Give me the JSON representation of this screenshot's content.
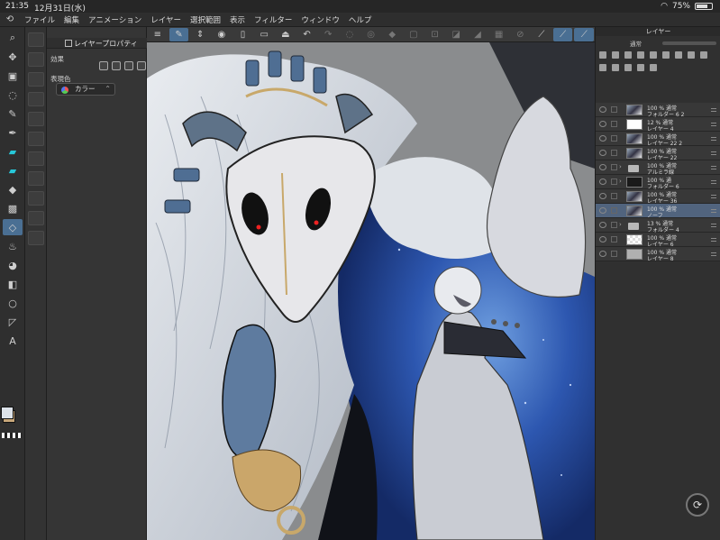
{
  "status": {
    "time": "21:35",
    "date": "12月31日(水)",
    "battery": "75%",
    "battery_level": 0.75,
    "wifi_icon": "wifi-icon"
  },
  "menu": [
    "ファイル",
    "編集",
    "アニメーション",
    "レイヤー",
    "選択範囲",
    "表示",
    "フィルター",
    "ウィンドウ",
    "ヘルプ"
  ],
  "property_panel": {
    "tab_title": "レイヤープロパティ",
    "effect_label": "効果",
    "color_label": "表現色",
    "color_value": "カラー"
  },
  "layer_panel": {
    "title": "レイヤー",
    "blend_mode": "通常",
    "layers": [
      {
        "opacity": "100 % 通常",
        "name": "フォルダー 6 2",
        "kind": "pic"
      },
      {
        "opacity": "12 % 通常",
        "name": "レイヤー 4",
        "kind": "white"
      },
      {
        "opacity": "100 % 通常",
        "name": "レイヤー 22 2",
        "kind": "pic"
      },
      {
        "opacity": "100 % 通常",
        "name": "レイヤー 22",
        "kind": "pic"
      },
      {
        "opacity": "100 % 通常",
        "name": "アルミラ線",
        "kind": "folder"
      },
      {
        "opacity": "100 % 通",
        "name": "フォルダー 6",
        "kind": "dark"
      },
      {
        "opacity": "100 % 通常",
        "name": "レイヤー 36",
        "kind": "pic"
      },
      {
        "opacity": "100 % 通常",
        "name": "ノーフ",
        "kind": "pic",
        "selected": true
      },
      {
        "opacity": "13 % 通常",
        "name": "フォルダー 4",
        "kind": "folder"
      },
      {
        "opacity": "100 % 通常",
        "name": "レイヤー 6",
        "kind": "checker"
      },
      {
        "opacity": "100 % 通常",
        "name": "レイヤー 8",
        "kind": "gray"
      }
    ]
  },
  "colors": {
    "accent": "#4a6f93",
    "selected_layer": "#51647e",
    "main_color": "#c7a77a",
    "sub_color": "#dde3ea"
  }
}
